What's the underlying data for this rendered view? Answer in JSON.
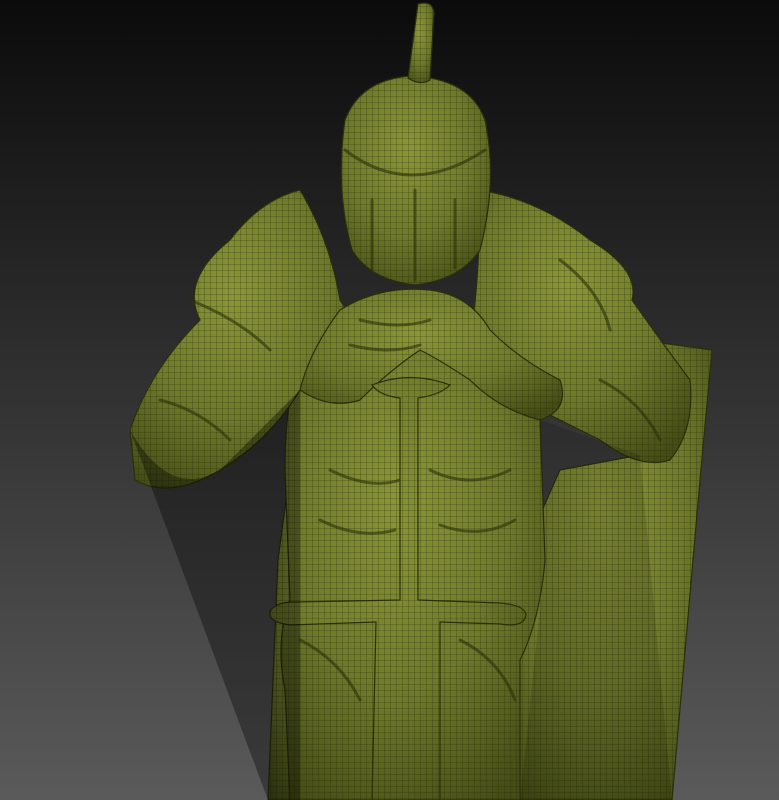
{
  "scene": {
    "subject": "knight-sculpt-wireframe",
    "colors": {
      "background_top": "#0b0b0b",
      "background_bottom": "#5a5a5a",
      "mesh_fill": "#6f7a2a",
      "mesh_fill_light": "#8a9636",
      "mesh_fill_dark": "#454d14",
      "wire": "#1d2208",
      "shadow": "#2a3008"
    }
  }
}
